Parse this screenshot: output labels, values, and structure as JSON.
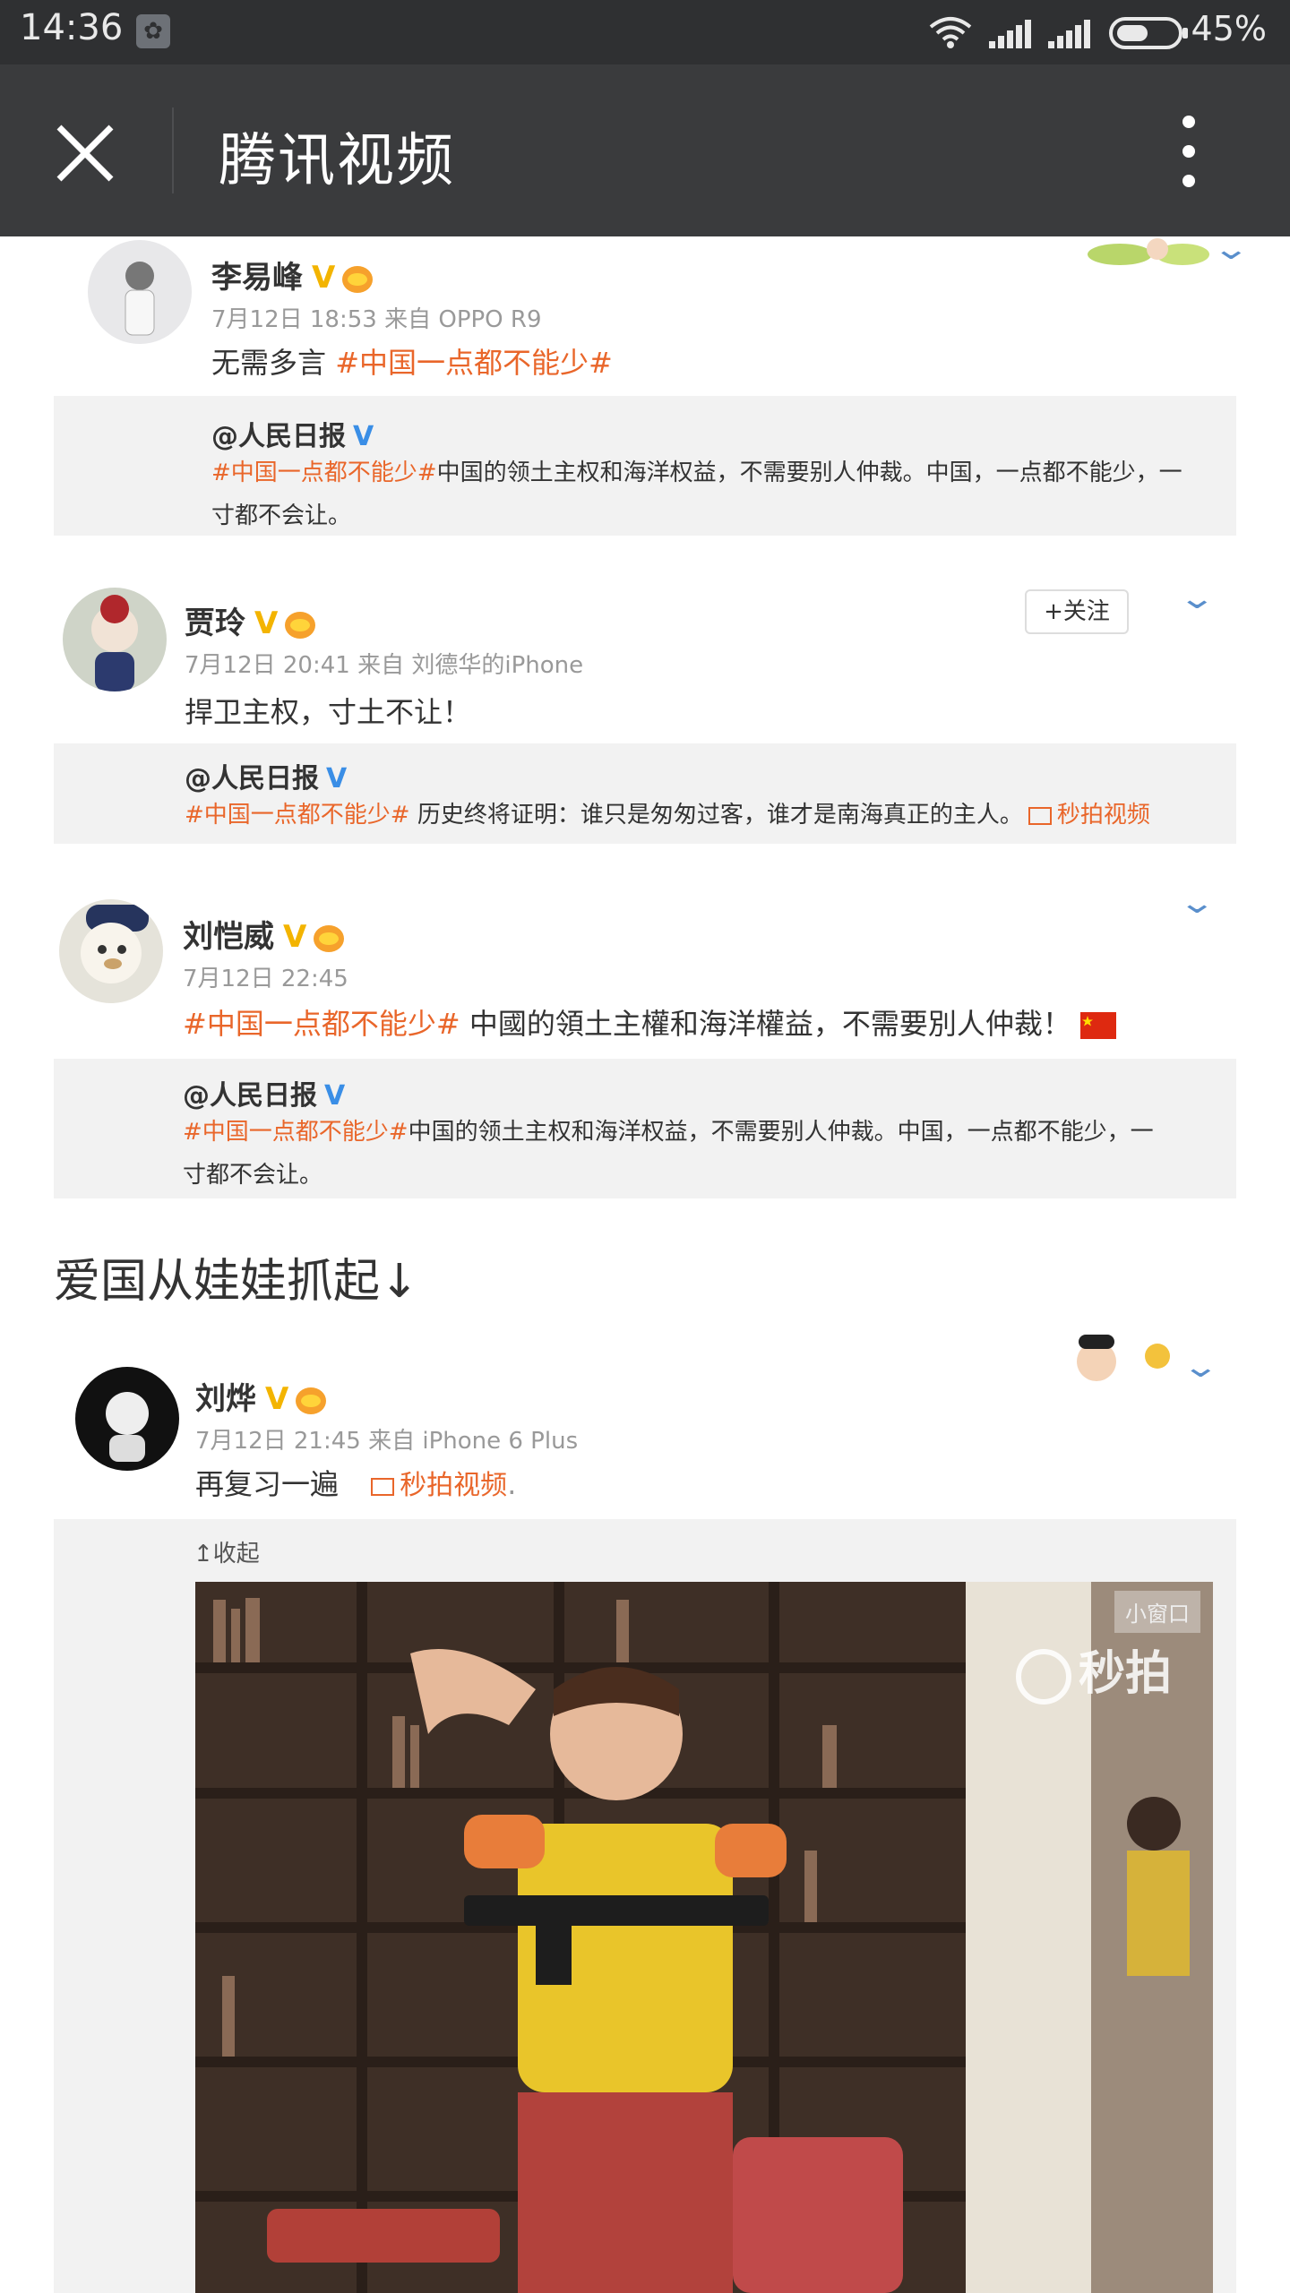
{
  "status_bar": {
    "time": "14:36",
    "battery": "45%"
  },
  "title_bar": {
    "title": "腾讯视频"
  },
  "posts": [
    {
      "name": "李易峰",
      "meta": "7月12日 18:53 来自 OPPO R9",
      "text_plain": "无需多言 ",
      "text_hashtag": "#中国一点都不能少#",
      "quote": {
        "name": "@人民日报",
        "hashtag": "#中国一点都不能少#",
        "line1": "中国的领土主权和海洋权益，不需要别人仲裁。中国，一点都不能少，一",
        "line2": "寸都不会让。"
      }
    },
    {
      "name": "贾玲",
      "meta": "7月12日 20:41 来自 刘德华的iPhone",
      "text_plain": "捍卫主权，寸土不让！",
      "follow": "+关注",
      "quote": {
        "name": "@人民日报",
        "hashtag": "#中国一点都不能少#",
        "line1": " 历史终将证明：谁只是匆匆过客，谁才是南海真正的主人。",
        "link": "秒拍视频"
      }
    },
    {
      "name": "刘恺威",
      "meta": "7月12日 22:45",
      "text_hashtag": "#中国一点都不能少#",
      "text_plain": " 中國的領土主權和海洋權益，不需要別人仲裁！",
      "quote": {
        "name": "@人民日报",
        "hashtag": "#中国一点都不能少#",
        "line1": "中国的领土主权和海洋权益，不需要别人仲裁。中国，一点都不能少，一",
        "line2": "寸都不会让。"
      }
    }
  ],
  "section_heading": "爱国从娃娃抓起↓",
  "post4": {
    "name": "刘烨",
    "meta": "7月12日 21:45 来自 iPhone 6 Plus",
    "text_plain": "再复习一遍",
    "link": "秒拍视频",
    "link_suffix": ".",
    "collapse": "收起",
    "video_tag": "小窗口",
    "watermark": "秒拍"
  }
}
